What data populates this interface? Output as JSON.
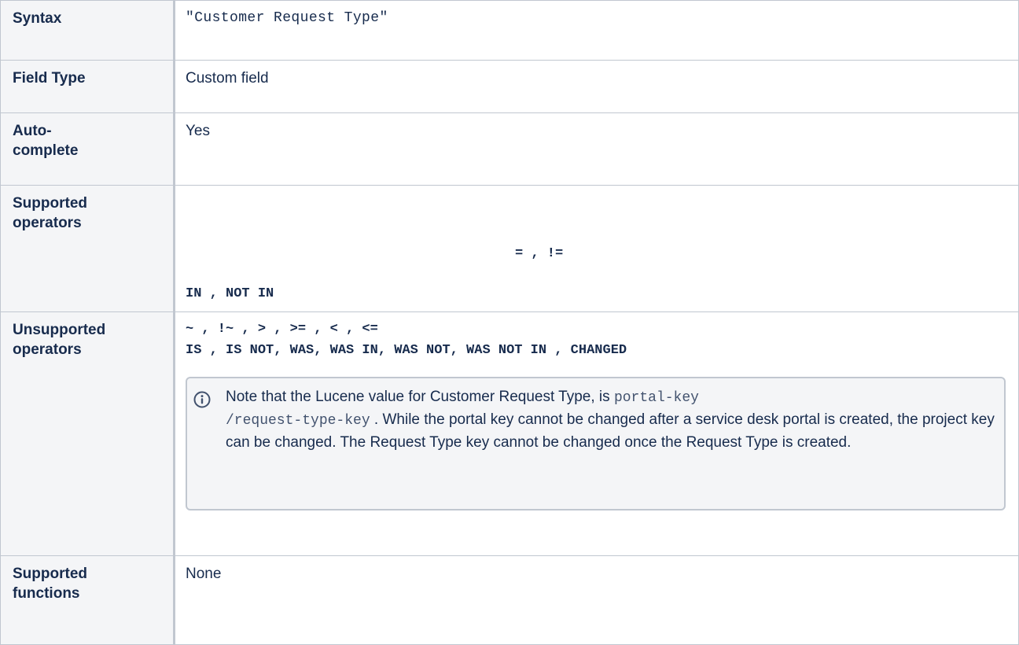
{
  "rows": {
    "syntax": {
      "label": "Syntax",
      "value": "\"Customer Request Type\""
    },
    "field_type": {
      "label": "Field Type",
      "value": "Custom field"
    },
    "auto_complete": {
      "label_line1": "Auto-",
      "label_line2": "complete",
      "value": "Yes"
    },
    "supported_operators": {
      "label_line1": "Supported",
      "label_line2": "operators",
      "line1": "= , !=",
      "line2": "IN , NOT IN"
    },
    "unsupported_operators": {
      "label_line1": "Unsupported",
      "label_line2": "operators",
      "line1": "~ , !~ , > , >= , < , <=",
      "line2": "IS , IS NOT, WAS, WAS IN, WAS NOT, WAS NOT IN , CHANGED",
      "note": {
        "icon": "info-icon",
        "text_before": "Note that the Lucene value for Customer Request Type, is ",
        "code_part1": "portal-key",
        "code_part2": "/request-type-key",
        "text_after": " . While the portal key cannot be changed after a service desk portal is created, the project key can be changed. The Request Type key cannot be changed once the Request Type is created."
      }
    },
    "supported_functions": {
      "label_line1": "Supported",
      "label_line2": "functions",
      "value": "None"
    }
  },
  "colors": {
    "header_bg": "#f4f5f7",
    "border": "#c1c7d0",
    "text": "#172b4d",
    "info_icon": "#42526e"
  }
}
